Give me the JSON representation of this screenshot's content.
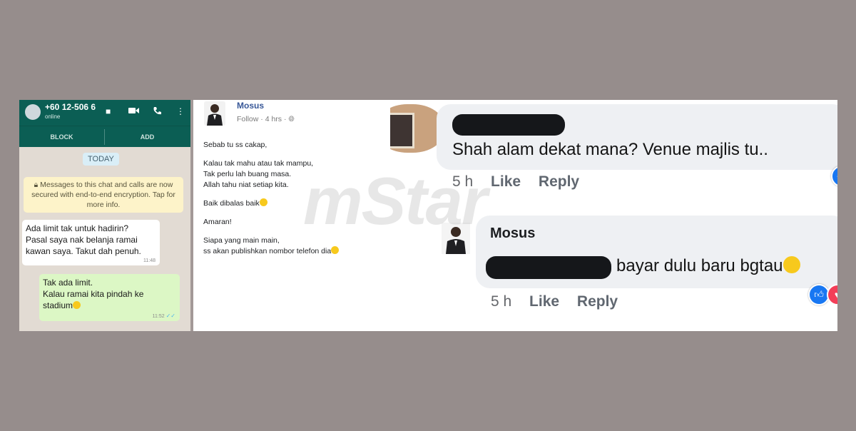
{
  "whatsapp": {
    "contact": "+60 12-506 6",
    "status": "online",
    "block_label": "BLOCK",
    "add_label": "ADD",
    "date_chip": "TODAY",
    "security_notice": "Messages to this chat and calls are now secured with end-to-end encryption. Tap for more info.",
    "messages": [
      {
        "direction": "in",
        "text": "Ada limit tak untuk hadirin?\nPasal saya nak belanja ramai\nkawan saya. Takut dah penuh.",
        "time": "11:48"
      },
      {
        "direction": "out",
        "text": "Tak ada limit.\nKalau ramai kita pindah ke\nstadium",
        "time": "11:52"
      }
    ],
    "colors": {
      "header": "#0b5e54",
      "outgoing_bubble": "#dcf7c5"
    }
  },
  "post": {
    "author": "Mosus",
    "follow_label": "Follow",
    "time": "4 hrs",
    "paragraphs": [
      "Sebab tu ss cakap,",
      "Kalau tak mahu atau tak mampu,\nTak perlu lah buang masa.\nAllah tahu niat setiap kita.",
      "Baik dibalas baik",
      "Amaran!",
      "Siapa yang main main,\nss akan publishkan nombor telefon dia"
    ]
  },
  "comments": [
    {
      "text": "Shah alam dekat mana? Venue majlis tu..",
      "time": "5 h",
      "like_label": "Like",
      "reply_label": "Reply"
    },
    {
      "author": "Mosus",
      "text": "bayar dulu baru bgtau",
      "time": "5 h",
      "like_label": "Like",
      "reply_label": "Reply"
    }
  ],
  "watermark": "mStar",
  "colors": {
    "background": "#968d8c",
    "like_blue": "#1877f2",
    "love_red": "#f33e58",
    "link": "#385898"
  }
}
